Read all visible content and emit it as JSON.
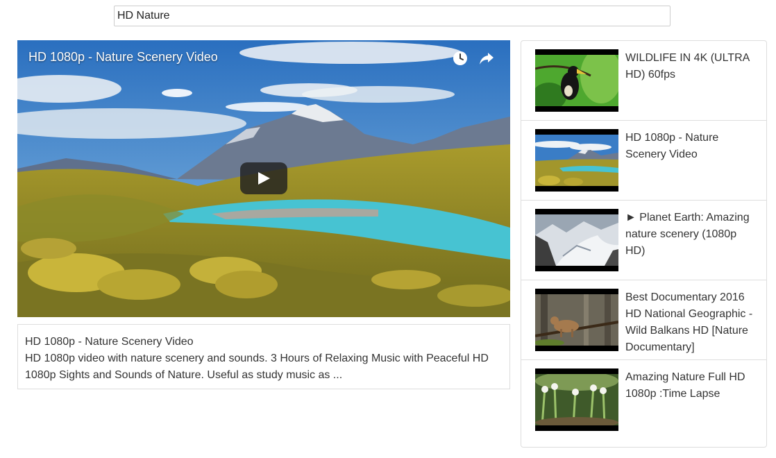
{
  "search": {
    "value": "HD Nature"
  },
  "player": {
    "title": "HD 1080p - Nature Scenery Video"
  },
  "details": {
    "title": "HD 1080p - Nature Scenery Video",
    "description": "HD 1080p video with nature scenery and sounds. 3 Hours of Relaxing Music with Peaceful HD 1080p Sights and Sounds of Nature. Useful as study music as ..."
  },
  "related": [
    {
      "title": "WILDLIFE IN 4K (ULTRA HD) 60fps"
    },
    {
      "title": "HD 1080p - Nature Scenery Video"
    },
    {
      "title": "► Planet Earth: Amazing nature scenery (1080p HD)"
    },
    {
      "title": "Best Documentary 2016 HD National Geographic - Wild Balkans HD [Nature Documentary]"
    },
    {
      "title": "Amazing Nature Full HD 1080p :Time Lapse"
    }
  ],
  "icons": {
    "watch_later": "clock-icon",
    "share": "share-icon",
    "play": "play-icon"
  },
  "colors": {
    "border": "#dddddd",
    "text": "#333333"
  }
}
